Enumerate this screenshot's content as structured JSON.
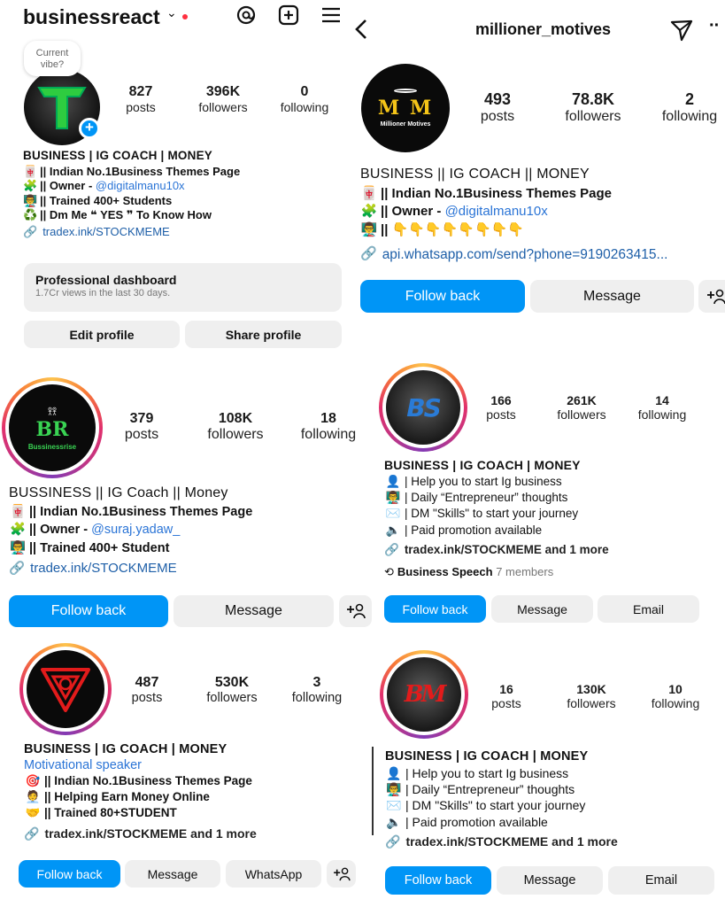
{
  "p1": {
    "username": "businessreact",
    "note": "Current vibe?",
    "stats": [
      {
        "num": "827",
        "label": "posts"
      },
      {
        "num": "396K",
        "label": "followers"
      },
      {
        "num": "0",
        "label": "following"
      }
    ],
    "bio_title": "BUSINESS | IG COACH | MONEY",
    "bio_lines": [
      {
        "emoji": "🀄",
        "text": "|| Indian No.1Business Themes Page"
      },
      {
        "emoji": "🧩",
        "text": "|| Owner - ",
        "mention": "@digitalmanu10x"
      },
      {
        "emoji": "👨‍🏫",
        "text": "|| Trained 400+ Students"
      },
      {
        "emoji": "♻️",
        "text": "|| Dm Me ❝ YES ❞ To Know How"
      }
    ],
    "link": "tradex.ink/STOCKMEME",
    "dashboard_title": "Professional dashboard",
    "dashboard_sub": "1.7Cr views in the last 30 days.",
    "edit_label": "Edit profile",
    "share_label": "Share profile"
  },
  "p2": {
    "username": "millioner_motives",
    "logo_text": "M M",
    "logo_sub": "Millioner Motives",
    "stats": [
      {
        "num": "493",
        "label": "posts"
      },
      {
        "num": "78.8K",
        "label": "followers"
      },
      {
        "num": "2",
        "label": "following"
      }
    ],
    "bio_title": "BUSINESS || IG COACH || MONEY",
    "bio_lines": [
      {
        "emoji": "🀄",
        "text": "|| Indian No.1Business Themes Page"
      },
      {
        "emoji": "🧩",
        "text": "|| Owner - ",
        "mention": "@digitalmanu10x"
      },
      {
        "emoji": "👨‍🏫",
        "text": "|| 👇👇👇👇👇👇👇👇"
      }
    ],
    "link": "api.whatsapp.com/send?phone=9190263415...",
    "follow_label": "Follow back",
    "message_label": "Message"
  },
  "p3": {
    "logo_text": "BR",
    "logo_sub": "Bussinessrise",
    "stats": [
      {
        "num": "379",
        "label": "posts"
      },
      {
        "num": "108K",
        "label": "followers"
      },
      {
        "num": "18",
        "label": "following"
      }
    ],
    "bio_title": "BUSSINESS || IG Coach || Money",
    "bio_lines": [
      {
        "emoji": "🀄",
        "text": "|| Indian No.1Business Themes Page"
      },
      {
        "emoji": "🧩",
        "text": "|| Owner - ",
        "mention": "@suraj.yadaw_"
      },
      {
        "emoji": "👨‍🏫",
        "text": "|| Trained 400+ Student"
      }
    ],
    "link": "tradex.ink/STOCKMEME",
    "follow_label": "Follow back",
    "message_label": "Message"
  },
  "p4": {
    "logo_text": "BS",
    "stats": [
      {
        "num": "166",
        "label": "posts"
      },
      {
        "num": "261K",
        "label": "followers"
      },
      {
        "num": "14",
        "label": "following"
      }
    ],
    "bio_title": "BUSINESS | IG COACH | MONEY",
    "bio_lines": [
      {
        "emoji": "👤",
        "text": "| Help you to start Ig business"
      },
      {
        "emoji": "👨‍🏫",
        "text": "| Daily “Entrepreneur” thoughts"
      },
      {
        "emoji": "✉️",
        "text": "| DM \"Skills\" to start your journey"
      },
      {
        "emoji": "🔈",
        "text": "| Paid promotion available"
      }
    ],
    "link": "tradex.ink/STOCKMEME and 1 more",
    "channel_name": "Business Speech",
    "channel_members": "7 members",
    "follow_label": "Follow back",
    "message_label": "Message",
    "email_label": "Email"
  },
  "p5": {
    "stats": [
      {
        "num": "487",
        "label": "posts"
      },
      {
        "num": "530K",
        "label": "followers"
      },
      {
        "num": "3",
        "label": "following"
      }
    ],
    "bio_title": "BUSINESS | IG COACH | MONEY",
    "category": "Motivational speaker",
    "bio_lines": [
      {
        "emoji": "🎯",
        "text": "|| Indian No.1Business Themes Page"
      },
      {
        "emoji": "🧑‍💼",
        "text": "|| Helping Earn Money Online"
      },
      {
        "emoji": "🤝",
        "text": "|| Trained 80+STUDENT"
      }
    ],
    "link": "tradex.ink/STOCKMEME and 1 more",
    "follow_label": "Follow back",
    "message_label": "Message",
    "whatsapp_label": "WhatsApp"
  },
  "p6": {
    "logo_text": "BM",
    "stats": [
      {
        "num": "16",
        "label": "posts"
      },
      {
        "num": "130K",
        "label": "followers"
      },
      {
        "num": "10",
        "label": "following"
      }
    ],
    "bio_title": "BUSINESS | IG COACH | MONEY",
    "bio_lines": [
      {
        "emoji": "👤",
        "text": "| Help you to start Ig business"
      },
      {
        "emoji": "👨‍🏫",
        "text": "| Daily “Entrepreneur” thoughts"
      },
      {
        "emoji": "✉️",
        "text": "| DM \"Skills\" to start your journey"
      },
      {
        "emoji": "🔈",
        "text": "| Paid promotion available"
      }
    ],
    "link": "tradex.ink/STOCKMEME and 1 more",
    "follow_label": "Follow back",
    "message_label": "Message",
    "email_label": "Email"
  },
  "colors": {
    "accent": "#0095f6",
    "button_gray": "#efefef",
    "link": "#1e5fa8",
    "notification_dot": "#ff3040",
    "logo_green": "#2ecc40",
    "logo_gold": "#f5c518",
    "logo_red": "#e21b1b",
    "logo_blue": "#2a7bd6"
  }
}
